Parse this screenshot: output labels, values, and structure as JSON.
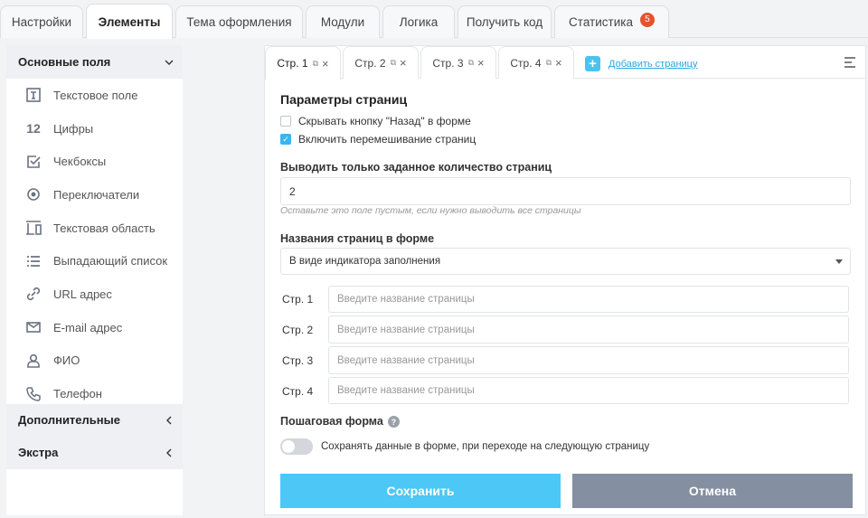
{
  "top_tabs": [
    {
      "label": "Настройки"
    },
    {
      "label": "Элементы"
    },
    {
      "label": "Тема оформления"
    },
    {
      "label": "Модули"
    },
    {
      "label": "Логика"
    },
    {
      "label": "Получить код"
    },
    {
      "label": "Статистика",
      "badge": "5"
    }
  ],
  "sidebar": {
    "group_main": "Основные поля",
    "items": [
      {
        "label": "Текстовое поле",
        "icon": "text-field-icon"
      },
      {
        "label": "Цифры",
        "icon": "numbers-icon",
        "glyph": "12"
      },
      {
        "label": "Чекбоксы",
        "icon": "checkbox-icon"
      },
      {
        "label": "Переключатели",
        "icon": "radio-icon"
      },
      {
        "label": "Текстовая область",
        "icon": "textarea-icon"
      },
      {
        "label": "Выпадающий список",
        "icon": "list-icon"
      },
      {
        "label": "URL адрес",
        "icon": "link-icon"
      },
      {
        "label": "E-mail адрес",
        "icon": "mail-icon"
      },
      {
        "label": "ФИО",
        "icon": "user-icon"
      },
      {
        "label": "Телефон",
        "icon": "phone-icon"
      }
    ],
    "group_extra": "Дополнительные",
    "group_ext": "Экстра"
  },
  "page_tabs": [
    {
      "label": "Стр. 1"
    },
    {
      "label": "Стр. 2"
    },
    {
      "label": "Стр. 3"
    },
    {
      "label": "Стр. 4"
    }
  ],
  "add_page_label": "Добавить страницу",
  "settings": {
    "title": "Параметры страниц",
    "hide_back_label": "Скрывать кнопку \"Назад\" в форме",
    "shuffle_label": "Включить перемешивание страниц",
    "limit_label": "Выводить только заданное количество страниц",
    "limit_value": "2",
    "limit_hint": "Оставьте это поле пустым, если нужно выводить все страницы",
    "names_label": "Названия страниц в форме",
    "names_select": "В виде индикатора заполнения",
    "page_names": [
      {
        "label": "Стр. 1",
        "placeholder": "Введите название страницы"
      },
      {
        "label": "Стр. 2",
        "placeholder": "Введите название страницы"
      },
      {
        "label": "Стр. 3",
        "placeholder": "Введите название страницы"
      },
      {
        "label": "Стр. 4",
        "placeholder": "Введите название страницы"
      }
    ],
    "step_label": "Пошаговая форма",
    "help_glyph": "?",
    "save_data_label": "Сохранять данные в форме, при переходе на следующую страницу"
  },
  "buttons": {
    "save": "Сохранить",
    "cancel": "Отмена"
  },
  "colors": {
    "accent": "#4dc7f6",
    "cancel": "#848fa1",
    "badge": "#e5532d"
  }
}
